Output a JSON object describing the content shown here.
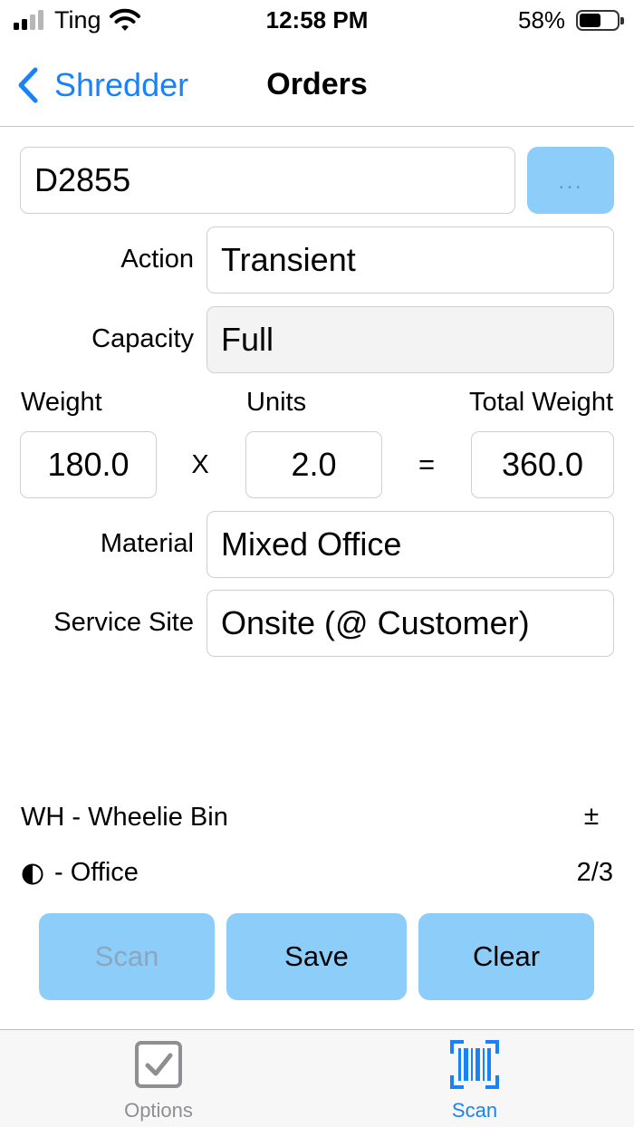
{
  "status_bar": {
    "carrier": "Ting",
    "time": "12:58 PM",
    "battery_percent": "58%",
    "battery_level": 0.58
  },
  "nav": {
    "back_label": "Shredder",
    "title": "Orders"
  },
  "form": {
    "order_id": "D2855",
    "more_button_label": "...",
    "action_label": "Action",
    "action_value": "Transient",
    "capacity_label": "Capacity",
    "capacity_value": "Full",
    "weight_label": "Weight",
    "units_label": "Units",
    "total_weight_label": "Total Weight",
    "weight_value": "180.0",
    "times_symbol": "X",
    "units_value": "2.0",
    "equals_symbol": "=",
    "total_weight_value": "360.0",
    "material_label": "Material",
    "material_value": "Mixed Office",
    "service_site_label": "Service Site",
    "service_site_value": "Onsite (@ Customer)"
  },
  "info": {
    "container_text": "WH - Wheelie Bin",
    "container_symbol": "±",
    "content_icon": "half-circle-icon",
    "content_text": "- Office",
    "count": "2/3"
  },
  "buttons": {
    "scan": "Scan",
    "save": "Save",
    "clear": "Clear"
  },
  "tabbar": {
    "tabs": [
      {
        "label": "Options",
        "icon": "checkbox-icon",
        "active": false
      },
      {
        "label": "Scan",
        "icon": "barcode-scan-icon",
        "active": true
      }
    ]
  },
  "colors": {
    "accent": "#1a82f7",
    "button_fill": "#8dcdfa",
    "inactive_tab": "#8e8e93"
  }
}
